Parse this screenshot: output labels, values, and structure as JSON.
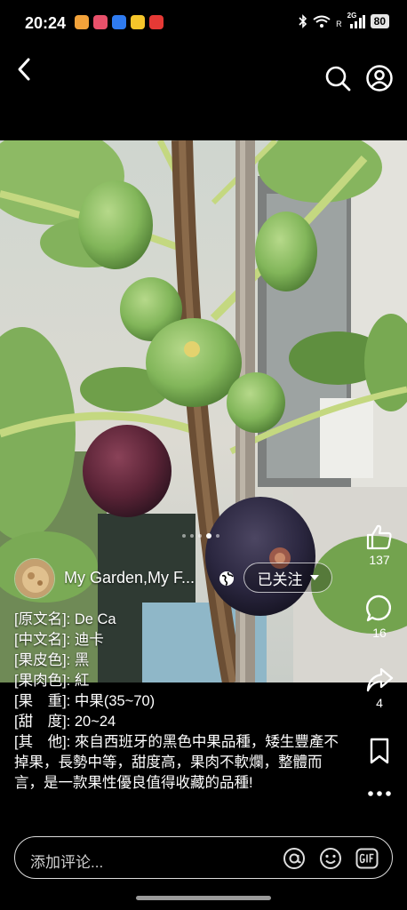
{
  "status_bar": {
    "time": "20:24",
    "network_label": "2G",
    "sim_label": "R",
    "battery": "80"
  },
  "header": {
    "back_icon": "chevron-left-icon",
    "search_icon": "search-icon",
    "profile_icon": "profile-icon"
  },
  "carousel": {
    "total": 5,
    "active": 3
  },
  "post": {
    "author": "My Garden,My F...",
    "follow_label": "已关注",
    "description": {
      "line1": "[原文名]: De Ca",
      "line2": "[中文名]: 迪卡",
      "line3": "[果皮色]: 黑",
      "line4": "[果肉色]: 紅",
      "line5": "[果　重]: 中果(35~70)",
      "line6": "[甜　度]: 20~24",
      "line7": "[其　他]: 來自西班牙的黑色中果品種，矮生豐產不掉果，長勢中等，甜度高，果肉不軟爛，整體而言，是一款果性優良值得收藏的品種!"
    }
  },
  "actions": {
    "likes": "137",
    "comments": "16",
    "shares": "4"
  },
  "comment_bar": {
    "placeholder": "添加评论..."
  },
  "colors": {
    "background": "#000000",
    "leaf_green": "#7fae5a",
    "fig_green": "#8fc06a",
    "fig_black": "#2a2438"
  }
}
